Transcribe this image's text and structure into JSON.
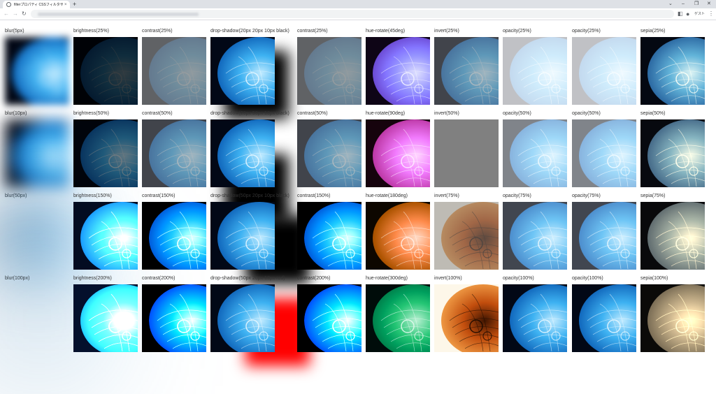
{
  "tab": {
    "title": "filterプロパティ CSSフィルタサンプル",
    "close_glyph": "×",
    "newtab_glyph": "+"
  },
  "window": {
    "collapse_glyph": "⌄",
    "minimize_glyph": "–",
    "restore_glyph": "❐",
    "close_glyph": "✕"
  },
  "toolbar": {
    "back_glyph": "←",
    "forward_glyph": "→",
    "reload_glyph": "↻",
    "sidepanel_glyph": "◧",
    "profile_glyph": "●",
    "guest_label": "ゲスト",
    "menu_glyph": "⋮"
  },
  "grid": {
    "columns": [
      [
        "blur(5px)",
        "blur(10px)",
        "blur(50px)",
        "blur(100px)"
      ],
      [
        "brightness(25%)",
        "brightness(50%)",
        "brightness(150%)",
        "brightness(200%)"
      ],
      [
        "contrast(25%)",
        "contrast(50%)",
        "contrast(150%)",
        "contrast(200%)"
      ],
      [
        "drop-shadow(20px 20px 10px black)",
        "drop-shadow(20px 50px 10px black)",
        "drop-shadow(50px 20px 10px black)",
        "drop-shadow(50px 20px 10px red)"
      ],
      [
        "contrast(25%)",
        "contrast(50%)",
        "contrast(150%)",
        "contrast(200%)"
      ],
      [
        "hue-rotate(45deg)",
        "hue-rotate(90deg)",
        "hue-rotate(180deg)",
        "hue-rotate(300deg)"
      ],
      [
        "invert(25%)",
        "invert(50%)",
        "invert(75%)",
        "invert(100%)"
      ],
      [
        "opacity(25%)",
        "opacity(50%)",
        "opacity(75%)",
        "opacity(100%)"
      ],
      [
        "opacity(25%)",
        "opacity(50%)",
        "opacity(75%)",
        "opacity(100%)"
      ],
      [
        "sepia(25%)",
        "sepia(50%)",
        "sepia(75%)",
        "sepia(100%)"
      ]
    ]
  }
}
